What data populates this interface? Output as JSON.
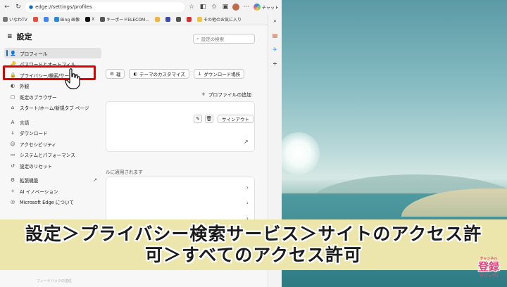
{
  "browser": {
    "url": "edge://settings/profiles",
    "copilot_label": "チャット"
  },
  "favorites": [
    {
      "label": "いなわTV",
      "color": "#777777"
    },
    {
      "label": "",
      "color": "#e74c3c"
    },
    {
      "label": "",
      "color": "#4285f4"
    },
    {
      "label": "Bing 画像",
      "color": "#2b88d8"
    },
    {
      "label": "X",
      "color": "#111111"
    },
    {
      "label": "キーボードELECOM...",
      "color": "#555555"
    },
    {
      "label": "",
      "color": "#f1b640"
    },
    {
      "label": "",
      "color": "#3949ab"
    },
    {
      "label": "",
      "color": "#555555"
    },
    {
      "label": "",
      "color": "#d32f2f"
    },
    {
      "label": "その他のお気に入り",
      "color": "#f0c24a"
    }
  ],
  "sidebar": {
    "title": "設定",
    "items": [
      {
        "label": "プロフィール",
        "icon": "person-icon",
        "glyph": "👤",
        "active": true
      },
      {
        "label": "パスワードとオートフィル",
        "icon": "key-icon",
        "glyph": "🔑",
        "active": false
      },
      {
        "label": "プライバシー/検索/サービス",
        "icon": "lock-icon",
        "glyph": "🔒",
        "active": false
      },
      {
        "label": "外観",
        "icon": "palette-icon",
        "glyph": "◐",
        "active": false
      },
      {
        "label": "既定のブラウザー",
        "icon": "browser-icon",
        "glyph": "▢",
        "active": false
      },
      {
        "label": "スタート/ホーム/新規タブ ページ",
        "icon": "home-icon",
        "glyph": "⌂",
        "active": false
      },
      {
        "label": "言語",
        "icon": "language-icon",
        "glyph": "A",
        "active": false
      },
      {
        "label": "ダウンロード",
        "icon": "download-icon",
        "glyph": "↓",
        "active": false
      },
      {
        "label": "アクセシビリティ",
        "icon": "accessibility-icon",
        "glyph": "☺",
        "active": false
      },
      {
        "label": "システムとパフォーマンス",
        "icon": "system-icon",
        "glyph": "▭",
        "active": false
      },
      {
        "label": "設定のリセット",
        "icon": "reset-icon",
        "glyph": "↺",
        "active": false
      },
      {
        "label": "拡張機能",
        "icon": "extensions-icon",
        "glyph": "⚙",
        "active": false
      },
      {
        "label": "AI イノベーション",
        "icon": "ai-icon",
        "glyph": "✧",
        "active": false
      },
      {
        "label": "Microsoft Edge について",
        "icon": "edge-icon",
        "glyph": "◎",
        "active": false
      }
    ]
  },
  "main": {
    "search_placeholder": "設定の検索",
    "chips": [
      {
        "label": "理",
        "icon": "settings-icon",
        "glyph": "⚙"
      },
      {
        "label": "テーマのカスタマイズ",
        "icon": "palette-icon",
        "glyph": "◐"
      },
      {
        "label": "ダウンロード場所",
        "icon": "download-icon",
        "glyph": "↓"
      }
    ],
    "add_profile": "プロファイルの追加",
    "sign_out": "サインアウト",
    "applies_text": "ルに適用されます"
  },
  "overlay": {
    "highlight_label": "プライバシー/検索/サービス"
  },
  "caption": {
    "line1": "設定＞プライバシー検索サービス＞サイトのアクセス許",
    "line2": "可＞すべてのアクセス許可"
  },
  "badge": {
    "small": "チャンネル",
    "big": "登録",
    "click": "クリック!"
  },
  "footer": {
    "feedback": "フィードバックの送信"
  },
  "colors": {
    "highlight": "#e00000",
    "caption_bg": "#ece6ad",
    "accent": "#0f6cbd"
  }
}
